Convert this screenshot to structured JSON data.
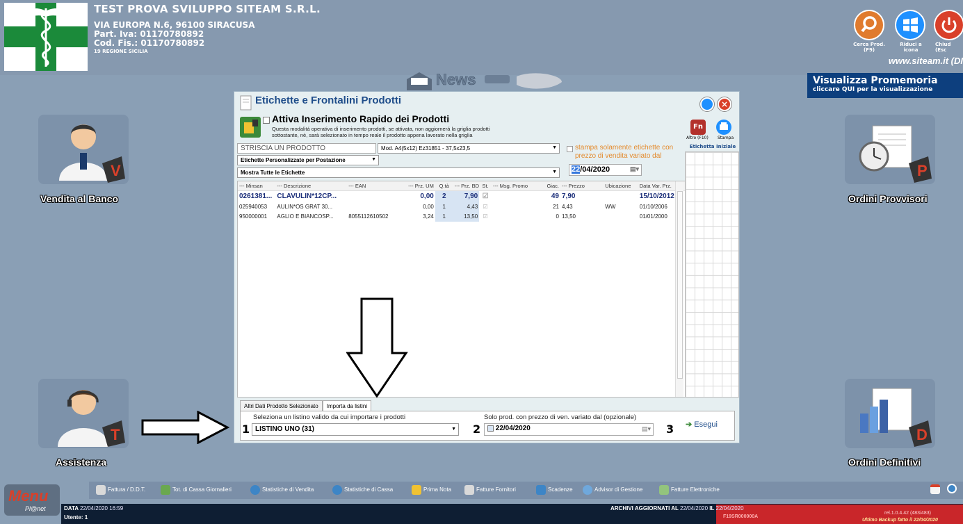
{
  "header": {
    "company": "TEST PROVA SVILUPPO SITEAM S.R.L.",
    "address": "VIA EUROPA N.6, 96100 SIRACUSA",
    "piva": "Part. Iva: 01170780892",
    "codfis": "Cod. Fis.: 01170780892",
    "region": "19 REGIONE SICILIA",
    "website": "www.siteam.it (DI",
    "buttons": [
      {
        "label": "Cerca Prod.",
        "sub": "(F9)",
        "icon": "search-icon"
      },
      {
        "label": "Riduci a",
        "sub": "icona",
        "icon": "windows-icon"
      },
      {
        "label": "Chiud",
        "sub": "(Esc",
        "icon": "power-icon"
      }
    ],
    "promo_title": "Visualizza Promemoria",
    "promo_sub": "cliccare QUI per la visualizzazione"
  },
  "tiles": {
    "vendita": "Vendita al Banco",
    "ordini_provvisori": "Ordini Provvisori",
    "assistenza": "Assistenza",
    "ordini_definitivi": "Ordini Definitivi"
  },
  "dialog": {
    "title": "Etichette e Frontalini Prodotti",
    "quick_title": "Attiva Inserimento Rapido dei Prodotti",
    "quick_desc_1": "Questa modalitá operativa di inserimento prodotti, se attivata, non aggiornerá la griglia prodotti",
    "quick_desc_2": "sottostante, nè, sarà selezionato in tempo reale il prodotto appena lavorato nella griglia",
    "altro_label": "Altro (F10)",
    "stampa_label": "Stampa",
    "etichetta_iniziale": "Etichetta Iniziale",
    "striscia_placeholder": "STRISCIA UN PRODOTTO",
    "modello": "Mod. A4(5x12) Ez31851 - 37,5x23,5",
    "etichette_pers": "Etichette Personalizzate per Postazione",
    "mostra": "Mostra Tutte le Etichette",
    "stampa_solo": "stampa solamente etichette con prezzo di vendita variato dal",
    "date_sel": "22",
    "date_rest": "/04/2020",
    "columns": [
      "--- Minsan",
      "--- Descrizione",
      "--- EAN",
      "--- Prz. UM",
      "Q.tà",
      "--- Prz. BD",
      "St.",
      "--- Msg. Promo",
      "Giac.",
      "--- Prezzo",
      "Ubicazione",
      "Data Var. Prz."
    ],
    "rows": [
      {
        "minsan": "0261381...",
        "descr": "CLAVULIN*12CP...",
        "ean": "",
        "przum": "0,00",
        "qta": "2",
        "przbd": "7,90",
        "st": "☑",
        "msg": "",
        "giac": "49",
        "prezzo": "7,90",
        "ubic": "",
        "data": "15/10/2012"
      },
      {
        "minsan": "025940053",
        "descr": "AULIN*OS GRAT 30...",
        "ean": "",
        "przum": "0,00",
        "qta": "1",
        "przbd": "4,43",
        "st": "☑",
        "msg": "",
        "giac": "21",
        "prezzo": "4,43",
        "ubic": "WW",
        "data": "01/10/2006"
      },
      {
        "minsan": "950000001",
        "descr": "AGLIO E BIANCOSP...",
        "ean": "8055112610502",
        "przum": "3,24",
        "qta": "1",
        "przbd": "13,50",
        "st": "☑",
        "msg": "",
        "giac": "0",
        "prezzo": "13,50",
        "ubic": "",
        "data": "01/01/2000"
      }
    ],
    "tabs": [
      "Altri Dati Prodotto Selezionato",
      "Importa da listini"
    ],
    "step1_num": "1",
    "step1_label": "Seleziona un listino valido da cui importare i prodotti",
    "listino": "LISTINO UNO (31)",
    "step2_num": "2",
    "step2_label": "Solo prod. con prezzo di ven. variato dal (opzionale)",
    "step2_date": "22/04/2020",
    "step3_num": "3",
    "esegui": "Esegui"
  },
  "taskbar": [
    {
      "label": "Fattura / D.D.T.",
      "color": "#d9d9d9"
    },
    {
      "label": "Tot. di Cassa Giornalieri",
      "color": "#6aa84f"
    },
    {
      "label": "Statistiche di Vendita",
      "color": "#3d85c6"
    },
    {
      "label": "Statistiche di Cassa",
      "color": "#3d85c6"
    },
    {
      "label": "Prima Nota",
      "color": "#f1c232"
    },
    {
      "label": "Fatture Fornitori",
      "color": "#d9d9d9"
    },
    {
      "label": "Scadenze",
      "color": "#3d85c6"
    },
    {
      "label": "Advisor di Gestione",
      "color": "#6fa8dc"
    },
    {
      "label": "Fatture Elettroniche",
      "color": "#93c47d"
    }
  ],
  "status": {
    "data_label": "DATA",
    "data_value": "22/04/2020  16:59",
    "utente": "Utente: 1",
    "archivi_label": "ARCHIVI AGGIORNATI AL",
    "archivi_value": "22/04/2020",
    "il_label": "IL",
    "il_value": "22/04/2020",
    "code": "F19SR000000A",
    "release": "rel.1.0.4.42 (483/483)",
    "backup": "Ultimo Backup fatto il  22/04/2020"
  }
}
